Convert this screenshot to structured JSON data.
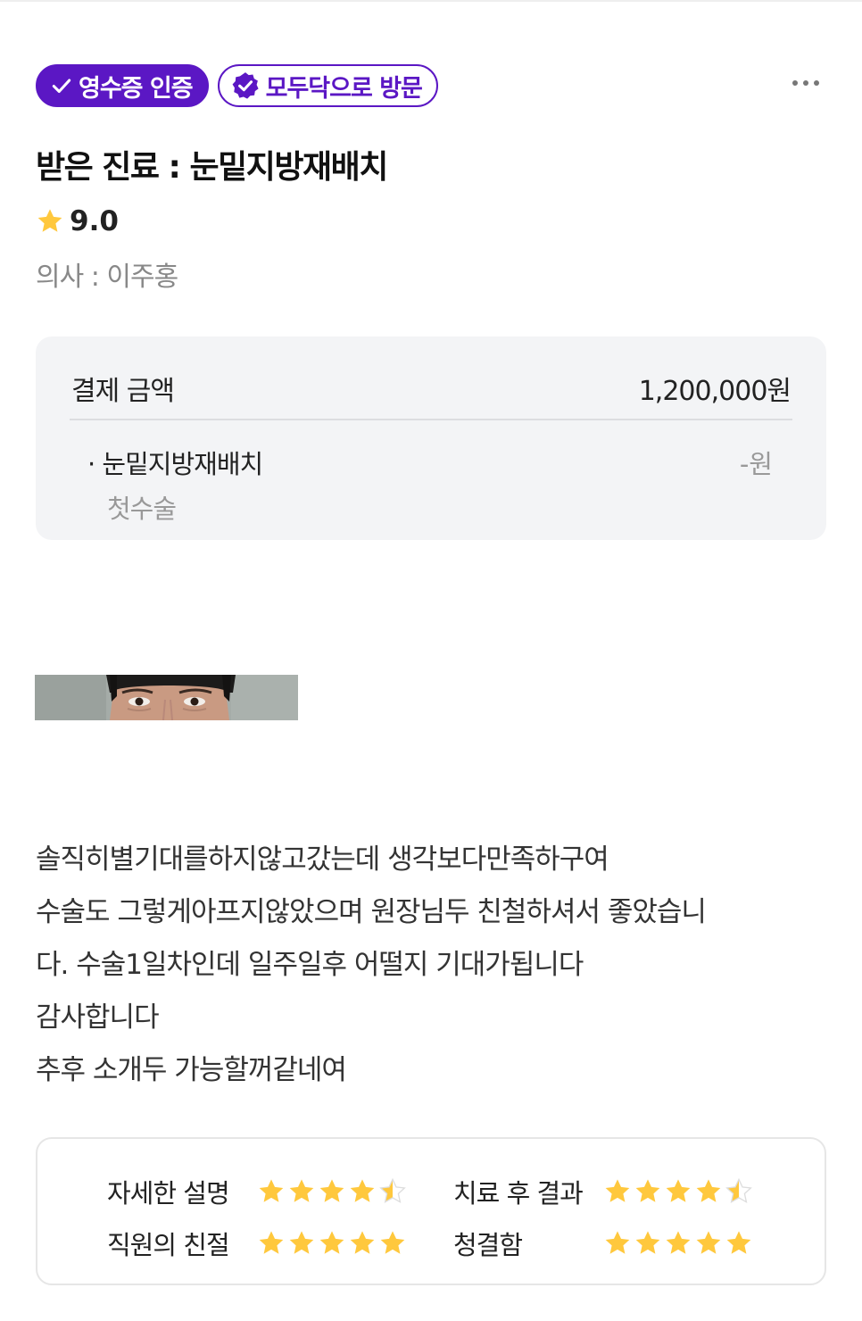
{
  "badges": {
    "receipt_label": "영수증 인증",
    "visit_label": "모두닥으로 방문"
  },
  "review": {
    "title": "받은 진료 : 눈밑지방재배치",
    "rating": "9.0",
    "doctor": "의사 : 이주홍",
    "body": "솔직히별기대를하지않고갔는데 생각보다만족하구여\n수술도 그렇게아프지않았으며 원장님두 친철하셔서 좋았습니\n다. 수술1일차인데 일주일후 어떨지 기대가됩니다\n감사합니다\n추후 소개두 가능할꺼같네여"
  },
  "payment": {
    "label": "결제 금액",
    "amount": "1,200,000원",
    "item_name": "· 눈밑지방재배치",
    "item_price": "-원",
    "item_note": "첫수술"
  },
  "scores": [
    {
      "label": "자세한 설명",
      "stars": 4.5
    },
    {
      "label": "치료 후 결과",
      "stars": 4.5
    },
    {
      "label": "직원의 친절",
      "stars": 5
    },
    {
      "label": "청결함",
      "stars": 5
    }
  ],
  "colors": {
    "accent": "#5b17c4",
    "star": "#ffc83d",
    "star_empty": "#dddddd"
  },
  "icons": {
    "receipt_badge": "check-icon",
    "visit_badge": "verified-seal-icon",
    "rating": "star-icon",
    "menu": "more-dots-icon"
  }
}
